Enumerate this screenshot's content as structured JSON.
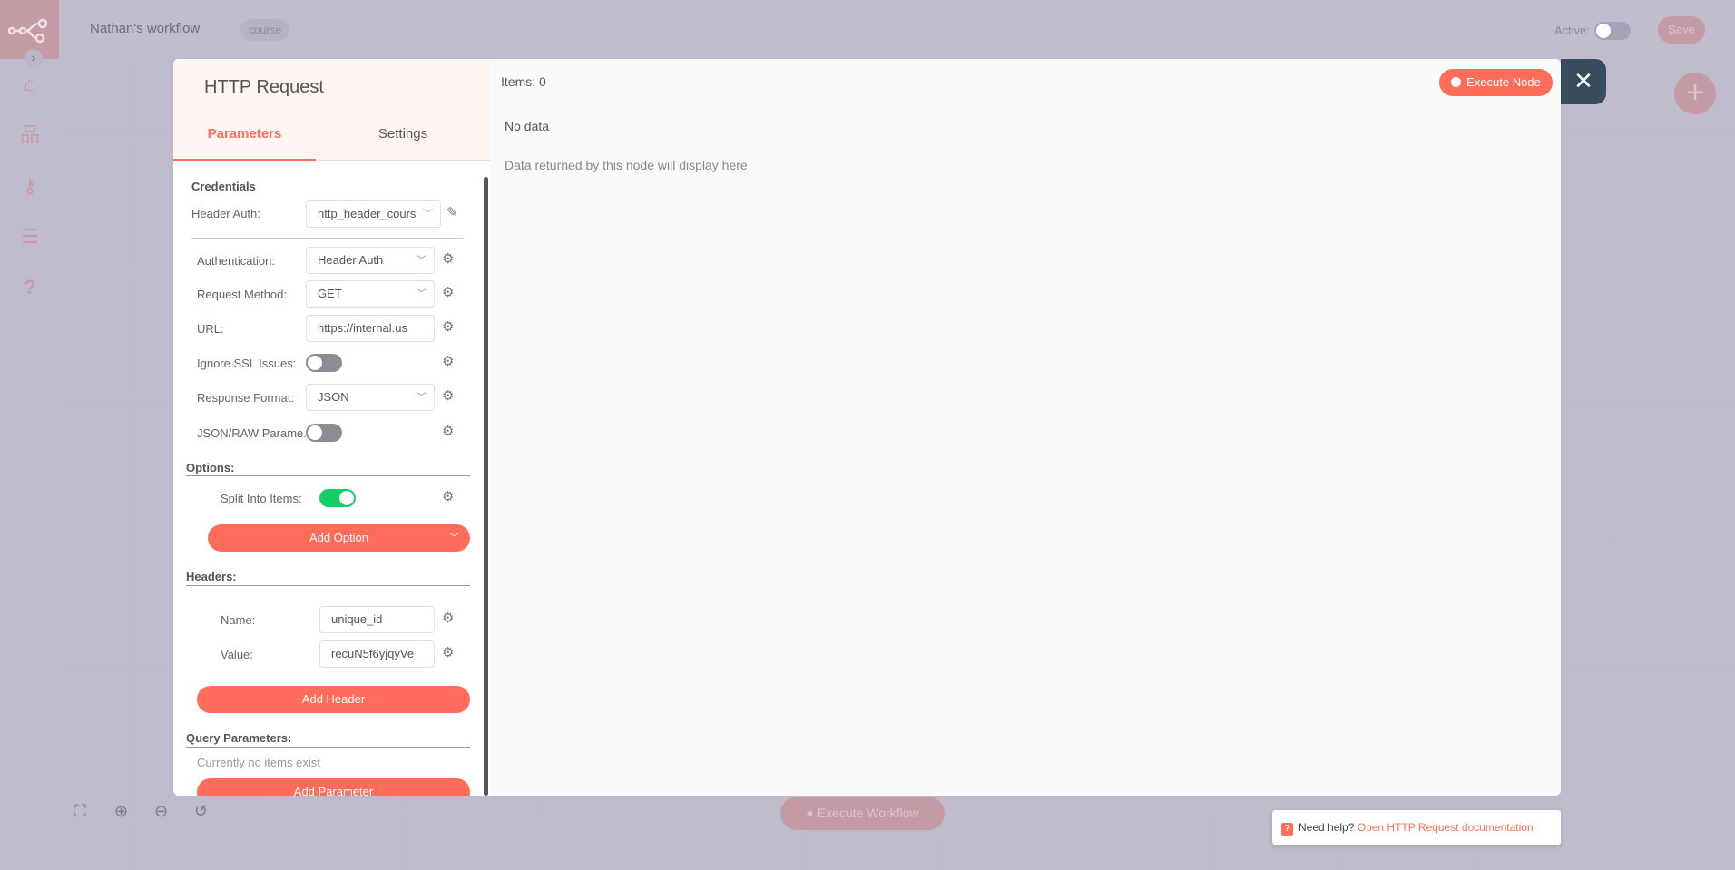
{
  "topbar": {
    "workflow_name": "Nathan's workflow",
    "tag": "course",
    "active_label": "Active:",
    "active": false,
    "save_label": "Save"
  },
  "sidebar": {
    "items": [
      "home-icon",
      "network-icon",
      "key-icon",
      "list-check-icon",
      "question-icon"
    ]
  },
  "node": {
    "title": "HTTP Request",
    "tabs": [
      {
        "label": "Parameters",
        "active": true
      },
      {
        "label": "Settings",
        "active": false
      }
    ],
    "credentials_label": "Credentials",
    "header_auth_label": "Header Auth:",
    "header_auth_value": "http_header_cours",
    "fields": [
      {
        "label": "Authentication:",
        "value": "Header Auth",
        "type": "select"
      },
      {
        "label": "Request Method:",
        "value": "GET",
        "type": "select"
      },
      {
        "label": "URL:",
        "value": "https://internal.us",
        "type": "input"
      },
      {
        "label": "Ignore SSL Issues:",
        "value": false,
        "type": "toggle"
      },
      {
        "label": "Response Format:",
        "value": "JSON",
        "type": "select"
      },
      {
        "label": "JSON/RAW Parame...",
        "value": false,
        "type": "toggle"
      }
    ],
    "options_label": "Options:",
    "split_label": "Split Into Items:",
    "split_value": true,
    "add_option": "Add Option",
    "headers_label": "Headers:",
    "header_name_label": "Name:",
    "header_name_value": "unique_id",
    "header_value_label": "Value:",
    "header_value_value": "recuN5f6yjqyVe",
    "add_header": "Add Header",
    "query_label": "Query Parameters:",
    "query_empty": "Currently no items exist",
    "add_parameter": "Add Parameter"
  },
  "output": {
    "items": "Items: 0",
    "execute_node": "Execute Node",
    "no_data": "No data",
    "hint": "Data returned by this node will display here"
  },
  "bottom": {
    "execute_workflow": "Execute Workflow",
    "help_prefix": "Need help?",
    "help_link": "Open HTTP Request documentation"
  },
  "colors": {
    "accent": "#ff6d5a",
    "toggle_on": "#13ce66",
    "close_bg": "#374c5c"
  }
}
